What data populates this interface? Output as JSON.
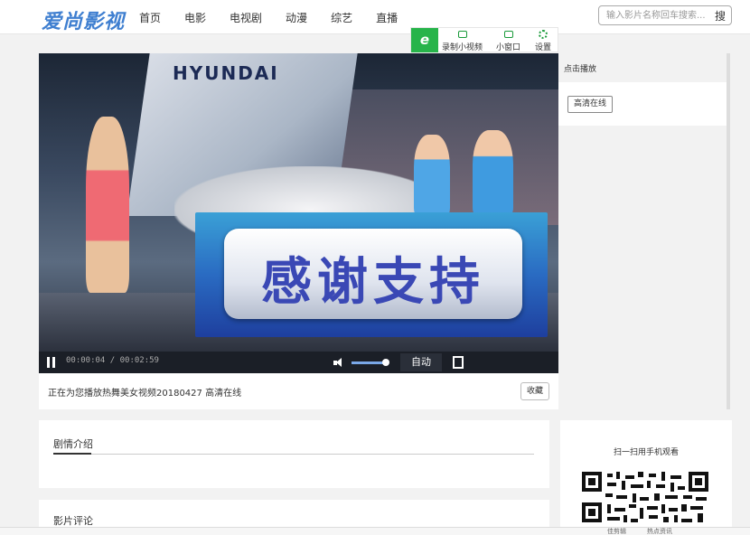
{
  "header": {
    "logo": "爱尚影视",
    "nav": [
      "首页",
      "电影",
      "电视剧",
      "动漫",
      "综艺",
      "直播"
    ],
    "search_placeholder": "输入影片名称回车搜索...",
    "search_button": "搜"
  },
  "player_tools": {
    "edge_icon": "e",
    "record": "录制小视频",
    "mini": "小窗口",
    "settings": "设置"
  },
  "video": {
    "stage_brand": "HYUNDAI",
    "banner_text": "感谢支持",
    "time_current": "00:00:04",
    "time_separator": "/",
    "time_total": "00:02:59",
    "quality": "自动",
    "volume_level": 0.85
  },
  "now_playing": {
    "text": "正在为您播放热舞美女视频20180427 高清在线",
    "favorite": "收藏"
  },
  "right_panel": {
    "header": "点击播放",
    "source": "高清在线"
  },
  "intro": {
    "title": "剧情介绍"
  },
  "review": {
    "title": "影片评论"
  },
  "qr": {
    "label": "扫一扫用手机观看"
  },
  "footer": {
    "item1": "佳剪辑",
    "item2": "热点资讯"
  }
}
